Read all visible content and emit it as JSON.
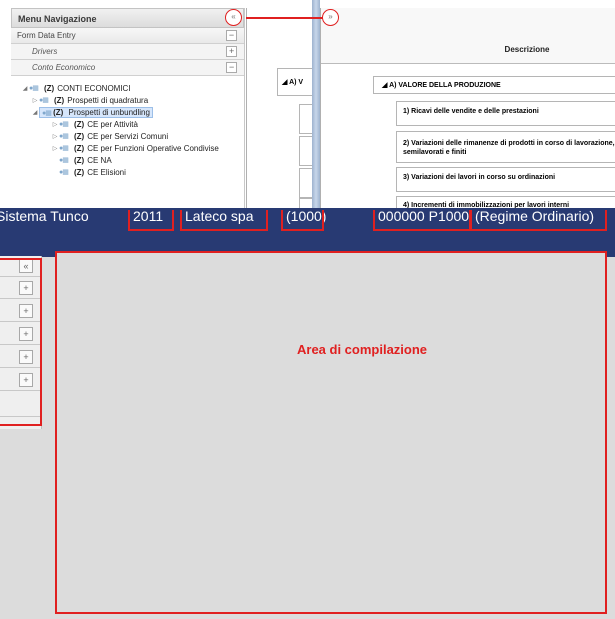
{
  "nav": {
    "title": "Menu Navigazione",
    "collapse_glyph": "«",
    "accordion": [
      {
        "label": "Form Data Entry",
        "state": "−"
      },
      {
        "label": "Drivers",
        "state": "+"
      },
      {
        "label": "Conto Economico",
        "state": "−"
      }
    ],
    "tree": [
      {
        "z": "(Z)",
        "label": "CONTI ECONOMICI",
        "indent": 0
      },
      {
        "z": "(Z)",
        "label": "Prospetti di quadratura",
        "indent": 1
      },
      {
        "z": "(Z)",
        "label": "Prospetti di unbundling",
        "indent": 1
      },
      {
        "z": "(Z)",
        "label": "CE per Attività",
        "indent": 2
      },
      {
        "z": "(Z)",
        "label": "CE per Servizi Comuni",
        "indent": 2
      },
      {
        "z": "(Z)",
        "label": "CE per Funzioni Operative Condivise",
        "indent": 2
      },
      {
        "z": "(Z)",
        "label": "CE NA",
        "indent": 2
      },
      {
        "z": "(Z)",
        "label": "CE Elisioni",
        "indent": 2
      }
    ]
  },
  "mid": {
    "section_label": "A) V"
  },
  "grid": {
    "expand_glyph": "»",
    "header": "Descrizione",
    "section": "A) VALORE DELLA PRODUZIONE",
    "items": [
      "1) Ricavi delle vendite e delle prestazioni",
      "2) Variazioni delle rimanenze di prodotti in corso di lavorazione, semilavorati e finiti",
      "3) Variazioni dei lavori in corso su ordinazioni",
      "4) Incrementi di immobilizzazioni per lavori interni"
    ]
  },
  "titlebar": {
    "segments": [
      "Sistema Tunco",
      "2011",
      "Lateco spa",
      "(1000)",
      "000000 P1000",
      "(Regime Ordinario)"
    ]
  },
  "sidebar": {
    "collapse_glyph": "«",
    "buttons": [
      "+",
      "+",
      "+",
      "+",
      "+"
    ]
  },
  "area": {
    "label": "Area di compilazione"
  },
  "colors": {
    "annotation_red": "#e02020",
    "titlebar_bg": "#283a73",
    "selection_bg": "#d6e6fb"
  }
}
